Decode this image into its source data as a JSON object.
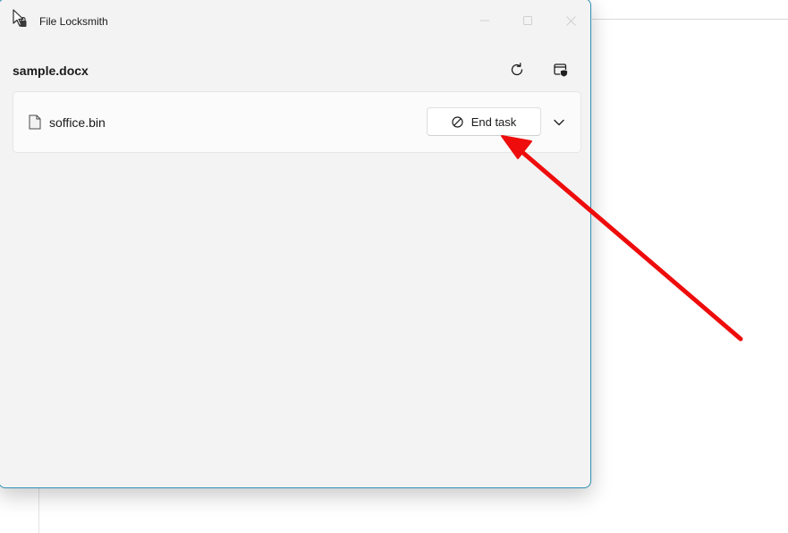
{
  "window": {
    "title": "File Locksmith",
    "controls": [
      "minimize-icon",
      "maximize-icon",
      "close-icon"
    ]
  },
  "file": {
    "name": "sample.docx"
  },
  "toolbar": {
    "icons": [
      "refresh-icon",
      "admin-shield-icon"
    ]
  },
  "processes": [
    {
      "name": "soffice.bin",
      "icon": "file-icon",
      "action_label": "End task",
      "action_icon": "block-icon",
      "expand_icon": "chevron-down-icon"
    }
  ],
  "annotation": {
    "color": "#ee0c0c"
  },
  "colors": {
    "window_border": "#2f8fb3",
    "window_bg": "#f3f3f3"
  }
}
